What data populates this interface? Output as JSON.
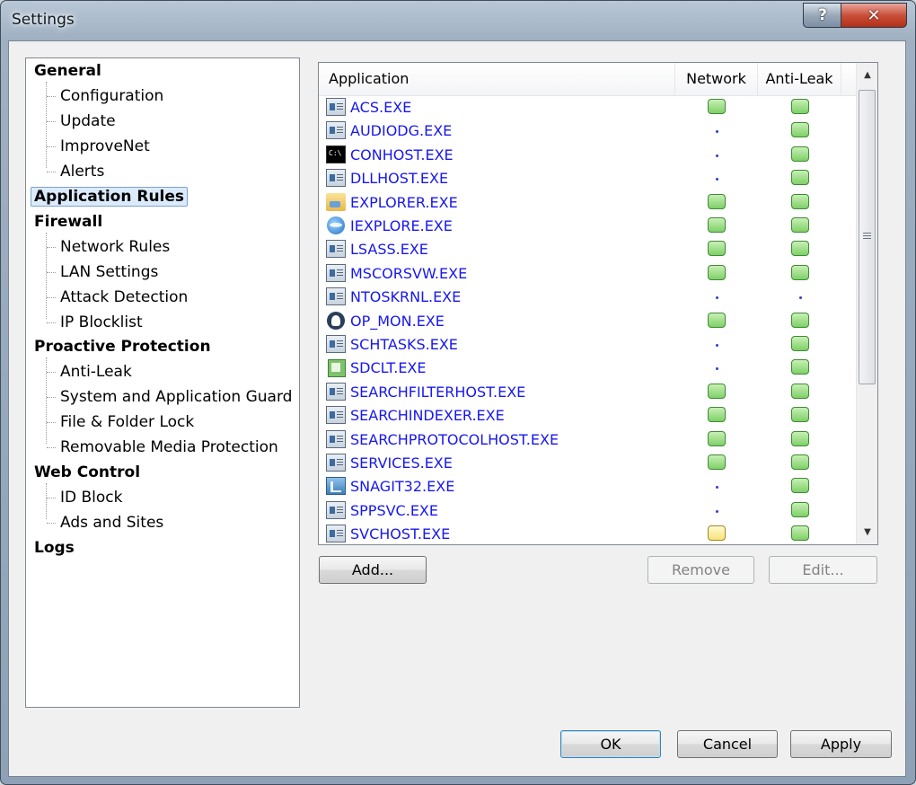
{
  "window": {
    "title": "Settings",
    "help_label": "?",
    "close_label": "✕"
  },
  "nav": {
    "groups": [
      {
        "label": "General",
        "children": [
          "Configuration",
          "Update",
          "ImproveNet",
          "Alerts"
        ]
      },
      {
        "label": "Application Rules",
        "children": []
      },
      {
        "label": "Firewall",
        "children": [
          "Network Rules",
          "LAN Settings",
          "Attack Detection",
          "IP Blocklist"
        ]
      },
      {
        "label": "Proactive Protection",
        "children": [
          "Anti-Leak",
          "System and Application Guard",
          "File & Folder Lock",
          "Removable Media Protection"
        ]
      },
      {
        "label": "Web Control",
        "children": [
          "ID Block",
          "Ads and Sites"
        ]
      },
      {
        "label": "Logs",
        "children": []
      }
    ],
    "selected": "Application Rules"
  },
  "app_list": {
    "columns": {
      "application": "Application",
      "network": "Network",
      "anti_leak": "Anti-Leak"
    },
    "rows": [
      {
        "name": "ACS.EXE",
        "icon": "app-window-icon",
        "network": "allow",
        "anti_leak": "allow"
      },
      {
        "name": "AUDIODG.EXE",
        "icon": "app-window-icon",
        "network": "none",
        "anti_leak": "allow"
      },
      {
        "name": "CONHOST.EXE",
        "icon": "console-icon",
        "network": "none",
        "anti_leak": "allow"
      },
      {
        "name": "DLLHOST.EXE",
        "icon": "app-window-icon",
        "network": "none",
        "anti_leak": "allow"
      },
      {
        "name": "EXPLORER.EXE",
        "icon": "folder-icon",
        "network": "allow",
        "anti_leak": "allow"
      },
      {
        "name": "IEXPLORE.EXE",
        "icon": "internet-explorer-icon",
        "network": "allow",
        "anti_leak": "allow"
      },
      {
        "name": "LSASS.EXE",
        "icon": "app-window-icon",
        "network": "allow",
        "anti_leak": "allow"
      },
      {
        "name": "MSCORSVW.EXE",
        "icon": "app-window-icon",
        "network": "allow",
        "anti_leak": "allow"
      },
      {
        "name": "NTOSKRNL.EXE",
        "icon": "app-window-icon",
        "network": "none",
        "anti_leak": "none"
      },
      {
        "name": "OP_MON.EXE",
        "icon": "shield-icon",
        "network": "allow",
        "anti_leak": "allow"
      },
      {
        "name": "SCHTASKS.EXE",
        "icon": "app-window-icon",
        "network": "none",
        "anti_leak": "allow"
      },
      {
        "name": "SDCLT.EXE",
        "icon": "backup-icon",
        "network": "none",
        "anti_leak": "allow"
      },
      {
        "name": "SEARCHFILTERHOST.EXE",
        "icon": "app-window-icon",
        "network": "allow",
        "anti_leak": "allow"
      },
      {
        "name": "SEARCHINDEXER.EXE",
        "icon": "app-window-icon",
        "network": "allow",
        "anti_leak": "allow"
      },
      {
        "name": "SEARCHPROTOCOLHOST.EXE",
        "icon": "app-window-icon",
        "network": "allow",
        "anti_leak": "allow"
      },
      {
        "name": "SERVICES.EXE",
        "icon": "app-window-icon",
        "network": "allow",
        "anti_leak": "allow"
      },
      {
        "name": "SNAGIT32.EXE",
        "icon": "snagit-icon",
        "network": "none",
        "anti_leak": "allow"
      },
      {
        "name": "SPPSVC.EXE",
        "icon": "app-window-icon",
        "network": "none",
        "anti_leak": "allow"
      },
      {
        "name": "SVCHOST.EXE",
        "icon": "app-window-icon",
        "network": "ask",
        "anti_leak": "allow"
      }
    ],
    "scroll_up": "▲",
    "scroll_down": "▼"
  },
  "buttons": {
    "add": "Add...",
    "remove": "Remove",
    "edit": "Edit...",
    "ok": "OK",
    "cancel": "Cancel",
    "apply": "Apply"
  },
  "colors": {
    "app_link": "#1717ee",
    "status_allow": "#7fd067",
    "status_ask": "#f7e27a",
    "selection": "#dcebfc"
  }
}
